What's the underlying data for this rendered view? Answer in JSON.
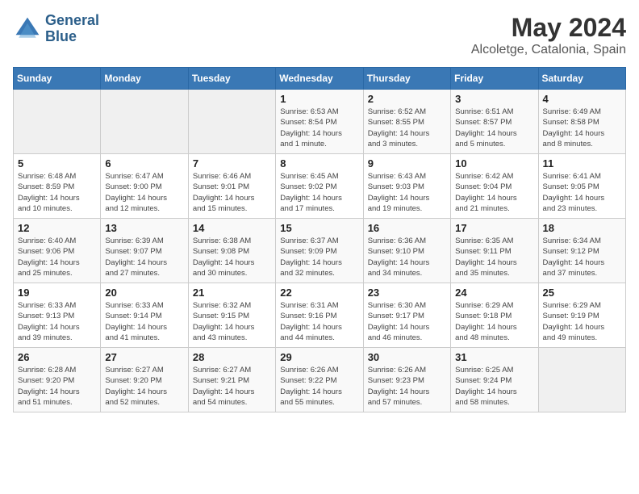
{
  "header": {
    "logo_line1": "General",
    "logo_line2": "Blue",
    "month_year": "May 2024",
    "location": "Alcoletge, Catalonia, Spain"
  },
  "days_of_week": [
    "Sunday",
    "Monday",
    "Tuesday",
    "Wednesday",
    "Thursday",
    "Friday",
    "Saturday"
  ],
  "weeks": [
    [
      {
        "day": "",
        "info": ""
      },
      {
        "day": "",
        "info": ""
      },
      {
        "day": "",
        "info": ""
      },
      {
        "day": "1",
        "info": "Sunrise: 6:53 AM\nSunset: 8:54 PM\nDaylight: 14 hours\nand 1 minute."
      },
      {
        "day": "2",
        "info": "Sunrise: 6:52 AM\nSunset: 8:55 PM\nDaylight: 14 hours\nand 3 minutes."
      },
      {
        "day": "3",
        "info": "Sunrise: 6:51 AM\nSunset: 8:57 PM\nDaylight: 14 hours\nand 5 minutes."
      },
      {
        "day": "4",
        "info": "Sunrise: 6:49 AM\nSunset: 8:58 PM\nDaylight: 14 hours\nand 8 minutes."
      }
    ],
    [
      {
        "day": "5",
        "info": "Sunrise: 6:48 AM\nSunset: 8:59 PM\nDaylight: 14 hours\nand 10 minutes."
      },
      {
        "day": "6",
        "info": "Sunrise: 6:47 AM\nSunset: 9:00 PM\nDaylight: 14 hours\nand 12 minutes."
      },
      {
        "day": "7",
        "info": "Sunrise: 6:46 AM\nSunset: 9:01 PM\nDaylight: 14 hours\nand 15 minutes."
      },
      {
        "day": "8",
        "info": "Sunrise: 6:45 AM\nSunset: 9:02 PM\nDaylight: 14 hours\nand 17 minutes."
      },
      {
        "day": "9",
        "info": "Sunrise: 6:43 AM\nSunset: 9:03 PM\nDaylight: 14 hours\nand 19 minutes."
      },
      {
        "day": "10",
        "info": "Sunrise: 6:42 AM\nSunset: 9:04 PM\nDaylight: 14 hours\nand 21 minutes."
      },
      {
        "day": "11",
        "info": "Sunrise: 6:41 AM\nSunset: 9:05 PM\nDaylight: 14 hours\nand 23 minutes."
      }
    ],
    [
      {
        "day": "12",
        "info": "Sunrise: 6:40 AM\nSunset: 9:06 PM\nDaylight: 14 hours\nand 25 minutes."
      },
      {
        "day": "13",
        "info": "Sunrise: 6:39 AM\nSunset: 9:07 PM\nDaylight: 14 hours\nand 27 minutes."
      },
      {
        "day": "14",
        "info": "Sunrise: 6:38 AM\nSunset: 9:08 PM\nDaylight: 14 hours\nand 30 minutes."
      },
      {
        "day": "15",
        "info": "Sunrise: 6:37 AM\nSunset: 9:09 PM\nDaylight: 14 hours\nand 32 minutes."
      },
      {
        "day": "16",
        "info": "Sunrise: 6:36 AM\nSunset: 9:10 PM\nDaylight: 14 hours\nand 34 minutes."
      },
      {
        "day": "17",
        "info": "Sunrise: 6:35 AM\nSunset: 9:11 PM\nDaylight: 14 hours\nand 35 minutes."
      },
      {
        "day": "18",
        "info": "Sunrise: 6:34 AM\nSunset: 9:12 PM\nDaylight: 14 hours\nand 37 minutes."
      }
    ],
    [
      {
        "day": "19",
        "info": "Sunrise: 6:33 AM\nSunset: 9:13 PM\nDaylight: 14 hours\nand 39 minutes."
      },
      {
        "day": "20",
        "info": "Sunrise: 6:33 AM\nSunset: 9:14 PM\nDaylight: 14 hours\nand 41 minutes."
      },
      {
        "day": "21",
        "info": "Sunrise: 6:32 AM\nSunset: 9:15 PM\nDaylight: 14 hours\nand 43 minutes."
      },
      {
        "day": "22",
        "info": "Sunrise: 6:31 AM\nSunset: 9:16 PM\nDaylight: 14 hours\nand 44 minutes."
      },
      {
        "day": "23",
        "info": "Sunrise: 6:30 AM\nSunset: 9:17 PM\nDaylight: 14 hours\nand 46 minutes."
      },
      {
        "day": "24",
        "info": "Sunrise: 6:29 AM\nSunset: 9:18 PM\nDaylight: 14 hours\nand 48 minutes."
      },
      {
        "day": "25",
        "info": "Sunrise: 6:29 AM\nSunset: 9:19 PM\nDaylight: 14 hours\nand 49 minutes."
      }
    ],
    [
      {
        "day": "26",
        "info": "Sunrise: 6:28 AM\nSunset: 9:20 PM\nDaylight: 14 hours\nand 51 minutes."
      },
      {
        "day": "27",
        "info": "Sunrise: 6:27 AM\nSunset: 9:20 PM\nDaylight: 14 hours\nand 52 minutes."
      },
      {
        "day": "28",
        "info": "Sunrise: 6:27 AM\nSunset: 9:21 PM\nDaylight: 14 hours\nand 54 minutes."
      },
      {
        "day": "29",
        "info": "Sunrise: 6:26 AM\nSunset: 9:22 PM\nDaylight: 14 hours\nand 55 minutes."
      },
      {
        "day": "30",
        "info": "Sunrise: 6:26 AM\nSunset: 9:23 PM\nDaylight: 14 hours\nand 57 minutes."
      },
      {
        "day": "31",
        "info": "Sunrise: 6:25 AM\nSunset: 9:24 PM\nDaylight: 14 hours\nand 58 minutes."
      },
      {
        "day": "",
        "info": ""
      }
    ]
  ]
}
